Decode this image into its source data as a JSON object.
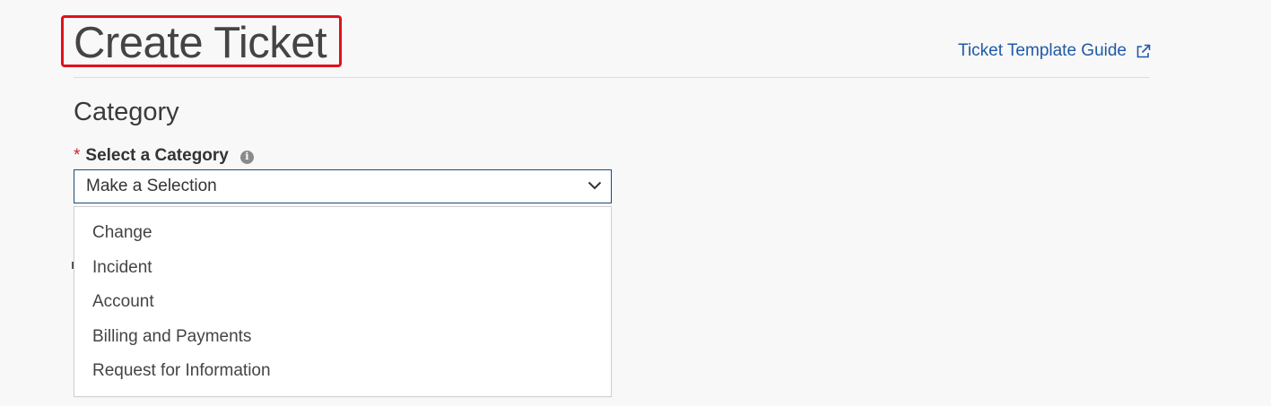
{
  "header": {
    "title": "Create Ticket",
    "guide_link_label": "Ticket Template Guide"
  },
  "form": {
    "section_heading": "Category",
    "category_field": {
      "required_marker": "*",
      "label": "Select a Category",
      "info_icon_glyph": "i",
      "selected_value": "Make a Selection",
      "options": [
        "Change",
        "Incident",
        "Account",
        "Billing and Payments",
        "Request for Information"
      ]
    }
  },
  "icons": {
    "external_link": "external-link-icon",
    "info": "info-icon",
    "chevron_down": "chevron-down-icon"
  },
  "colors": {
    "link": "#1f5aa6",
    "required": "#d0222e",
    "highlight_box": "#e0101c",
    "select_border": "#1c4a7a",
    "background": "#f8f8f8"
  }
}
